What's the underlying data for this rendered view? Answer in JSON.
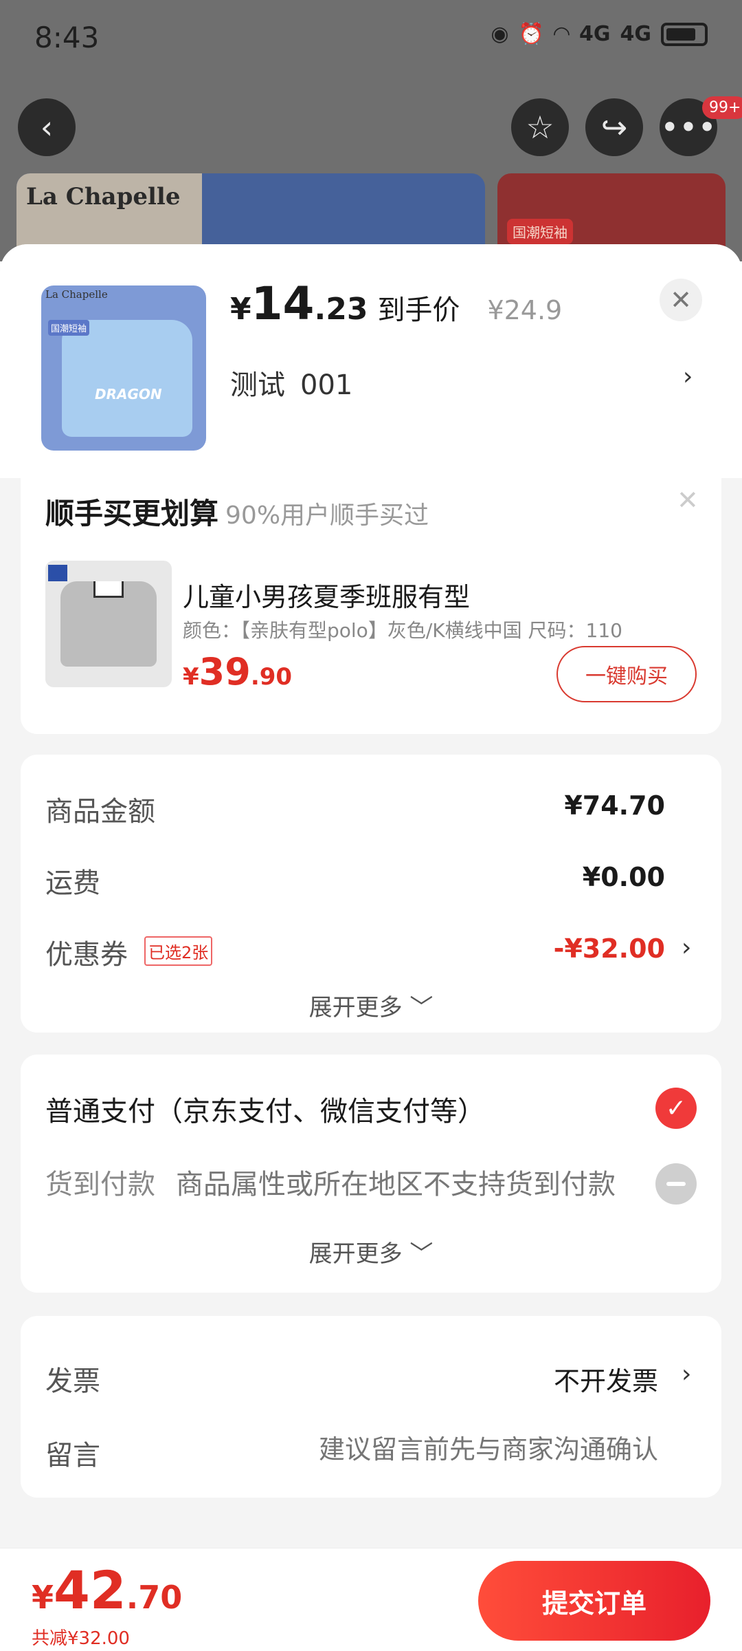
{
  "status_bar": {
    "time": "8:43",
    "network_1": "4G",
    "network_2": "4G"
  },
  "top_nav": {
    "back_icon": "chevron-left-icon",
    "favorite_icon": "star-icon",
    "share_icon": "share-icon",
    "more_icon": "more-dots-icon",
    "badge": "99+"
  },
  "background_banner": {
    "brand": "La Chapelle",
    "tag": "国潮短袖"
  },
  "product": {
    "thumb_brand": "La Chapelle",
    "thumb_tag": "国潮短袖",
    "thumb_text": "DRAGON",
    "price_yen": "¥",
    "price_int": "14",
    "price_dec": ".23",
    "price_label": "到手价",
    "original_price": "¥24.9",
    "spec_name": "测试",
    "spec_value": "001"
  },
  "addon": {
    "title": "顺手买更划算",
    "subtitle": "90%用户顺手买过",
    "name": "儿童小男孩夏季班服有型",
    "attrs": "颜色：【亲肤有型polo】灰色/K横线中国   尺码：110",
    "price_yen": "¥",
    "price_int": "39",
    "price_dec": ".90",
    "buy_label": "一键购买"
  },
  "amounts": {
    "goods_label": "商品金额",
    "goods_value": "¥74.70",
    "shipping_label": "运费",
    "shipping_value": "¥0.00",
    "coupon_label": "优惠券",
    "coupon_tag": "已选2张",
    "coupon_value": "-¥32.00",
    "expand_label": "展开更多 ﹀"
  },
  "payment": {
    "normal_label": "普通支付（京东支付、微信支付等）",
    "cod_label": "货到付款",
    "cod_note": "商品属性或所在地区不支持货到付款",
    "expand_label": "展开更多 ﹀"
  },
  "extras": {
    "invoice_label": "发票",
    "invoice_value": "不开发票",
    "message_label": "留言",
    "message_placeholder": "建议留言前先与商家沟通确认"
  },
  "footer": {
    "total_yen": "¥",
    "total_int": "42",
    "total_dec": ".70",
    "reduced": "共减¥32.00",
    "submit_label": "提交订单"
  },
  "colors": {
    "accent": "#e02e24",
    "check": "#f03a3a"
  }
}
